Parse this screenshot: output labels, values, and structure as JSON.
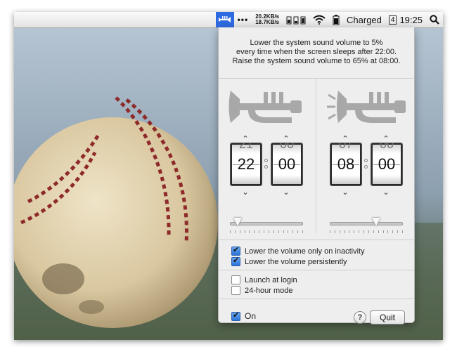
{
  "menubar": {
    "app_icon": "trumpet-icon",
    "more_icon": "ellipsis-icon",
    "net_up": "20.2KB/s",
    "net_down": "18.7KB/s",
    "wifi_icon": "wifi-icon",
    "battery_status": "Charged",
    "date_badge": "4",
    "time": "19:25",
    "search_icon": "search-icon"
  },
  "popover": {
    "description": [
      "Lower the system sound volume to 5%",
      "every time when the screen sleeps after 22:00.",
      "Raise the system sound volume to 65% at 08:00."
    ],
    "lower": {
      "hour": "22",
      "minute": "00",
      "hour_prev": "21",
      "volume_percent": 5
    },
    "raise": {
      "hour": "08",
      "minute": "00",
      "hour_prev": "07",
      "volume_percent": 65
    },
    "options": [
      {
        "label": "Lower the volume only on inactivity",
        "checked": true
      },
      {
        "label": "Lower the volume persistently",
        "checked": true
      },
      {
        "label": "Launch at login",
        "checked": false
      },
      {
        "label": "24-hour mode",
        "checked": false
      }
    ],
    "on_label": "On",
    "on_checked": true,
    "help_label": "?",
    "quit_label": "Quit"
  }
}
